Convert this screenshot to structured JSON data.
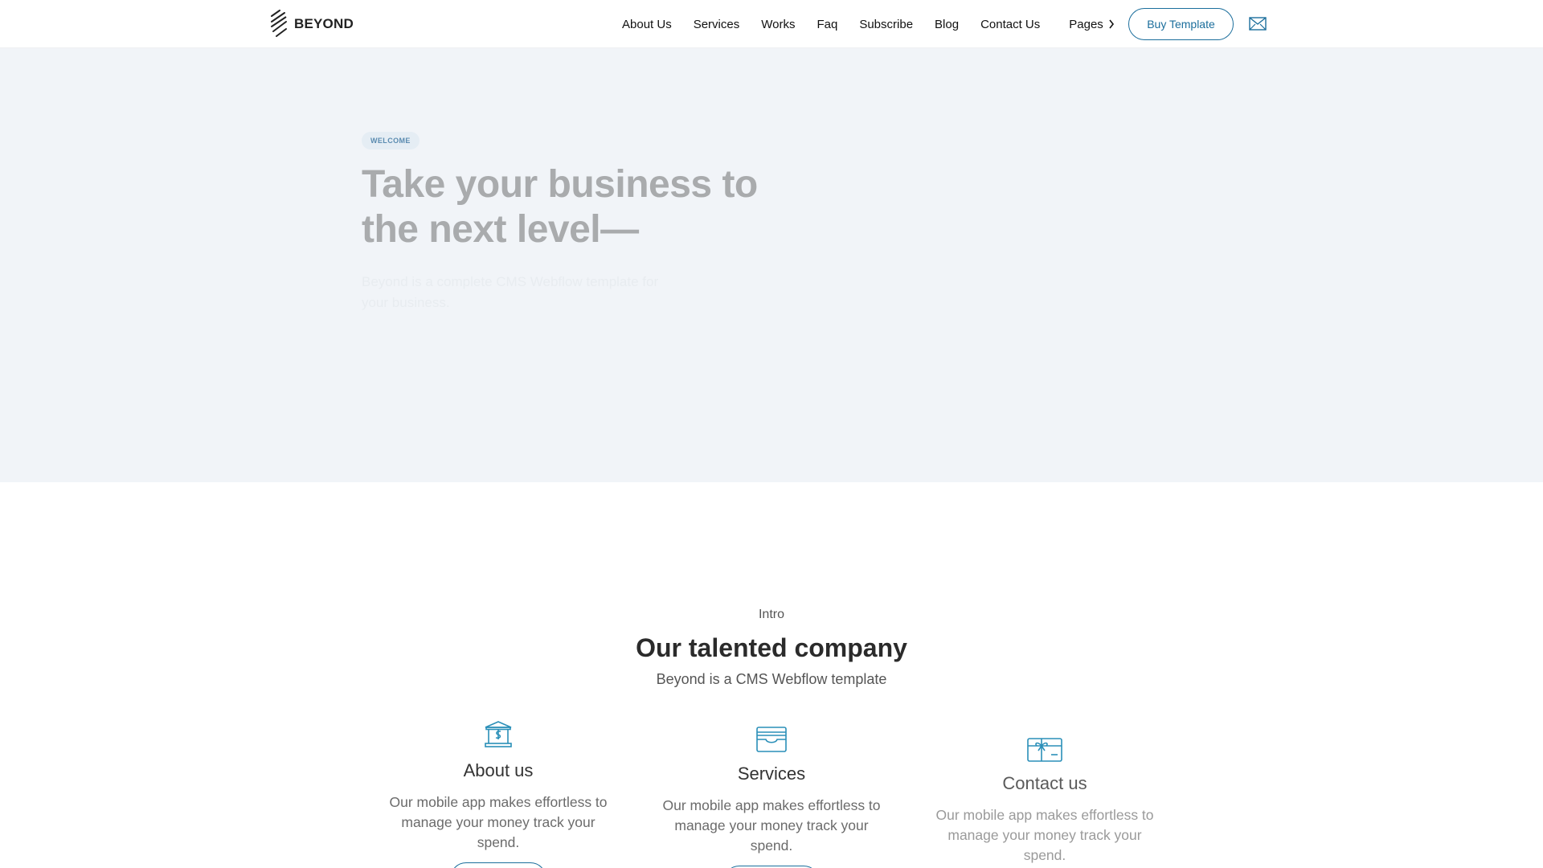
{
  "brand": {
    "name": "BEYOND"
  },
  "nav": {
    "links": [
      "About Us",
      "Services",
      "Works",
      "Faq",
      "Subscribe",
      "Blog",
      "Contact Us"
    ],
    "pages_label": "Pages",
    "buy_label": "Buy Template"
  },
  "hero": {
    "badge": "WELCOME",
    "title": "Take your business to the next level—",
    "subtitle": "Beyond is a complete CMS Webflow template for your business."
  },
  "intro": {
    "kicker": "Intro",
    "title": "Our talented company",
    "subtitle": "Beyond is a CMS Webflow template"
  },
  "cards": [
    {
      "icon": "bank-dollar-icon",
      "title": "About us",
      "text": "Our mobile app makes effortless to manage your money track your spend."
    },
    {
      "icon": "card-wallet-icon",
      "title": "Services",
      "text": "Our mobile app makes effortless to manage your money track your spend."
    },
    {
      "icon": "gift-card-icon",
      "title": "Contact us",
      "text": "Our mobile app makes effortless to manage your money track your spend."
    }
  ],
  "colors": {
    "accent": "#1b6e9c",
    "icon": "#2a8fb8",
    "hero_bg": "#f1f4f8"
  }
}
